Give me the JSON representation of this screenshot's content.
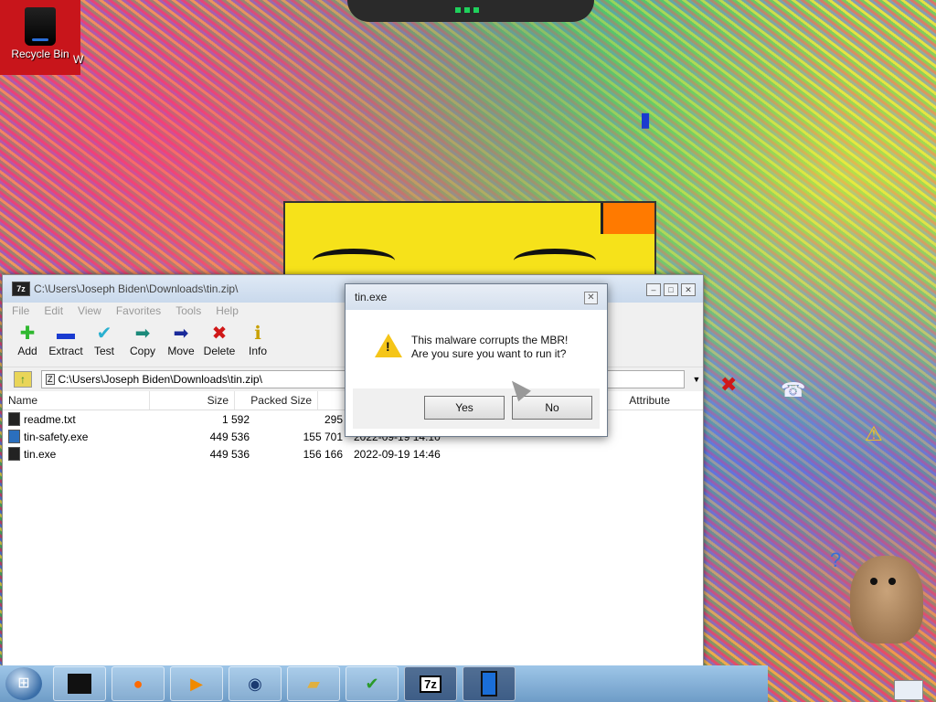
{
  "desktop": {
    "recycle_bin_label": "Recycle Bin",
    "second_icon_label": "W"
  },
  "zip_window": {
    "title": "C:\\Users\\Joseph Biden\\Downloads\\tin.zip\\",
    "app_icon_text": "7z",
    "menu": [
      "File",
      "Edit",
      "View",
      "Favorites",
      "Tools",
      "Help"
    ],
    "toolbar": [
      {
        "label": "Add",
        "icon": "plus-icon",
        "color": "#2fb82f"
      },
      {
        "label": "Extract",
        "icon": "minus-icon",
        "color": "#1a3bd0"
      },
      {
        "label": "Test",
        "icon": "check-icon",
        "color": "#2ab0d0"
      },
      {
        "label": "Copy",
        "icon": "copy-arrow-icon",
        "color": "#1b8a7a"
      },
      {
        "label": "Move",
        "icon": "move-arrow-icon",
        "color": "#1a2a9a"
      },
      {
        "label": "Delete",
        "icon": "delete-x-icon",
        "color": "#d01818"
      },
      {
        "label": "Info",
        "icon": "info-icon",
        "color": "#c8a000"
      }
    ],
    "address": "C:\\Users\\Joseph Biden\\Downloads\\tin.zip\\",
    "columns": {
      "name": "Name",
      "size": "Size",
      "packed": "Packed Size",
      "attributes": "Attribute"
    },
    "files": [
      {
        "name": "readme.txt",
        "size": "1 592",
        "packed": "295",
        "modified": ""
      },
      {
        "name": "tin-safety.exe",
        "size": "449 536",
        "packed": "155 701",
        "modified": "2022-09-19 14:10"
      },
      {
        "name": "tin.exe",
        "size": "449 536",
        "packed": "156 166",
        "modified": "2022-09-19 14:46"
      }
    ]
  },
  "dialog": {
    "title": "tin.exe",
    "line1": "This malware corrupts the MBR!",
    "line2": "Are you sure you want to run it?",
    "yes": "Yes",
    "no": "No"
  },
  "taskbar": {
    "items": [
      "terminal-icon",
      "firefox-icon",
      "media-player-icon",
      "globe-icon",
      "folder-icon",
      "checklist-icon",
      "7zip-icon",
      "device-icon"
    ],
    "archive_label": "7z"
  }
}
